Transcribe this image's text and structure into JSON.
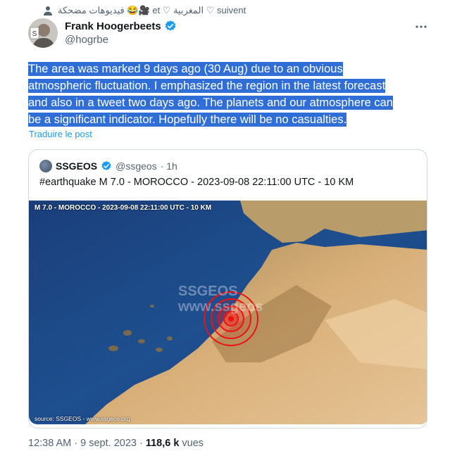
{
  "social_context": {
    "text": "فيديوهات مضحكة 😂🎥 et ♡ المغربية ♡ suivent"
  },
  "author": {
    "name": "Frank Hoogerbeets",
    "handle": "@hogrbe",
    "avatar_text": "S"
  },
  "tweet": {
    "lines": [
      "The area was marked 9 days ago (30 Aug) due to an obvious",
      "atmospheric fluctuation. I emphasized the region in the latest forecast",
      "and also in a tweet two days ago. The planets and our atmosphere can",
      "be a significant indicator. Hopefully there will be no casualties."
    ],
    "translate_label": "Traduire le post"
  },
  "quote": {
    "name": "SSGEOS",
    "handle": "@ssgeos",
    "time": "· 1h",
    "text": "#earthquake M 7.0 - MOROCCO - 2023-09-08 22:11:00 UTC - 10 KM",
    "map": {
      "title": "M 7.0 - MOROCCO - 2023-09-08 22:11:00 UTC - 10 KM",
      "watermark_1": "SSGEOS",
      "watermark_2": "www.ssgeos",
      "source": "source: SSGEOS - www.ssgeos.org"
    }
  },
  "meta": {
    "timestamp": "12:38 AM · 9 sept. 2023 ·",
    "views_count": "118,6 k",
    "views_label": "vues"
  },
  "colors": {
    "highlight": "#2f6ed6",
    "link": "#1d9bf0",
    "verified": "#1d9bf0",
    "muted": "#536471"
  }
}
